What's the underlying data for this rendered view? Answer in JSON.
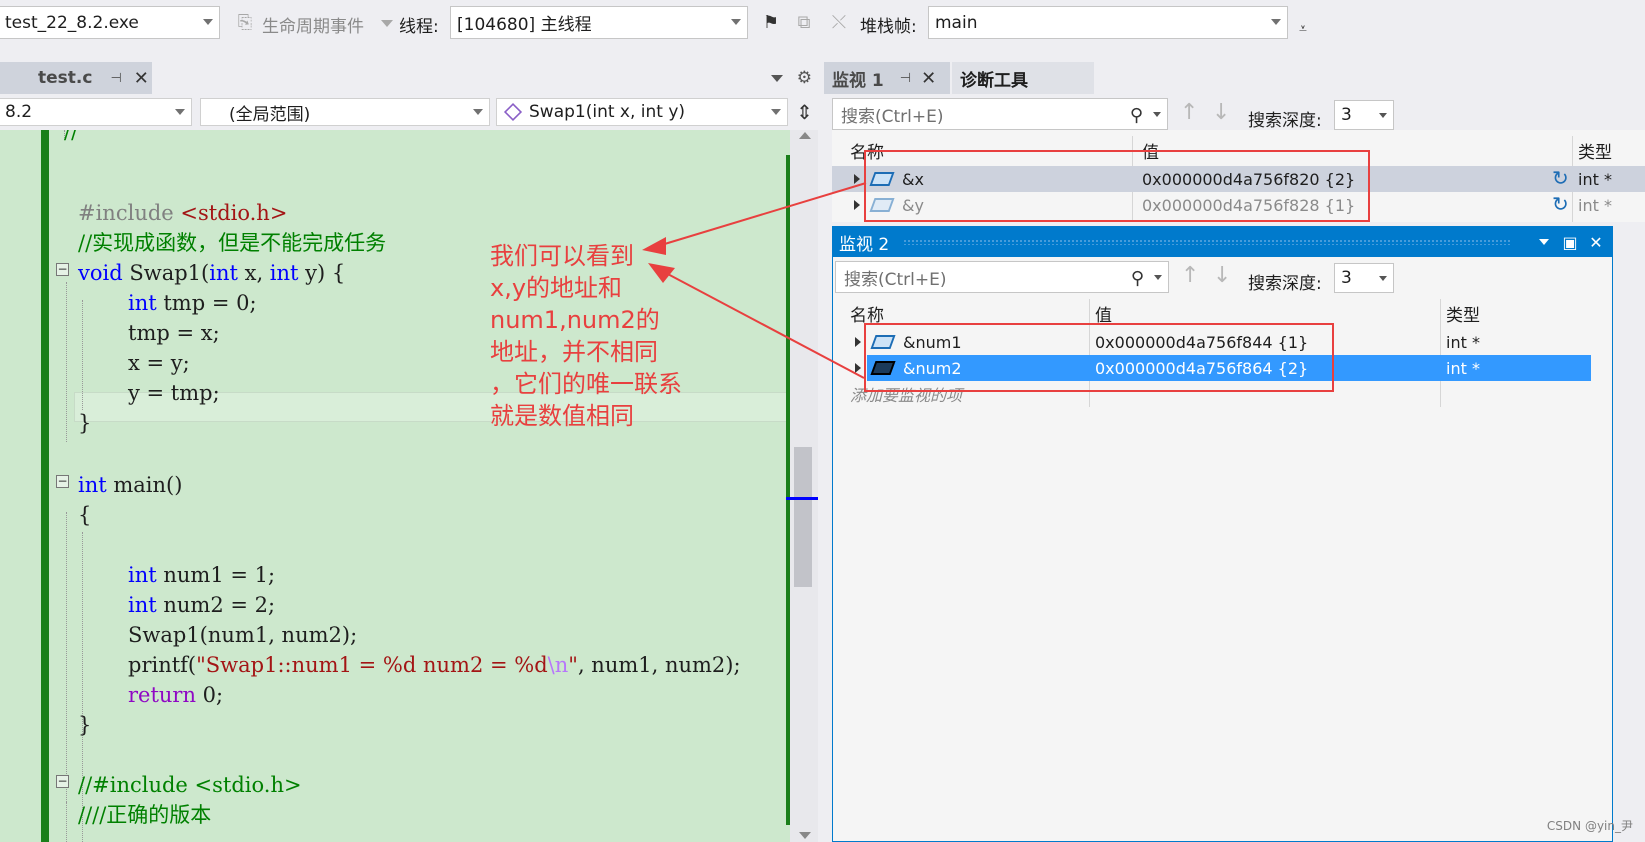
{
  "toolbar": {
    "process": "test_22_8.2.exe",
    "lifecycle": "生命周期事件",
    "thread_label": "线程:",
    "thread": "[104680] 主线程",
    "stack_label": "堆栈帧:",
    "stack": "main"
  },
  "editor": {
    "tab": "test.c",
    "nav_project": "8.2",
    "nav_scope": "(全局范围)",
    "nav_function": "Swap1(int x, int y)"
  },
  "code": {
    "l0": "//",
    "l1_pp": "#include ",
    "l1_hdr": "<stdio.h>",
    "l2": "//实现成函数，但是不能完成任务",
    "l3_kw": "void",
    "l3_a": " Swap1(",
    "l3_kw2": "int",
    "l3_b": " x, ",
    "l3_kw3": "int",
    "l3_c": " y) {",
    "l4_kw": "int",
    "l4_rest": " tmp = 0;",
    "l5": "tmp = x;",
    "l6": "x = y;",
    "l7": "y = tmp;",
    "l8": "}",
    "l10_kw": "int",
    "l10_rest": " main()",
    "l11": "{",
    "l13_kw": "int",
    "l13_rest": " num1 = 1;",
    "l14_kw": "int",
    "l14_rest": " num2 = 2;",
    "l15": "Swap1(num1, num2);",
    "l16_a": "printf(",
    "l16_str": "\"Swap1::num1 = %d num2 = %d",
    "l16_esc": "\\n",
    "l16_str2": "\"",
    "l16_b": ", num1, num2);",
    "l17_kw": "return",
    "l17_rest": " 0;",
    "l18": "}",
    "l20": "//#include <stdio.h>",
    "l21": "////正确的版本"
  },
  "watch1": {
    "tab": "监视 1",
    "tab2": "诊断工具",
    "search": "搜索(Ctrl+E)",
    "depth_label": "搜索深度:",
    "depth": "3",
    "col_name": "名称",
    "col_value": "值",
    "col_type": "类型",
    "rows": [
      {
        "name": "&x",
        "value": "0x000000d4a756f820 {2}",
        "type": "int *"
      },
      {
        "name": "&y",
        "value": "0x000000d4a756f828 {1}",
        "type": "int *"
      }
    ]
  },
  "watch2": {
    "title": "监视 2",
    "search": "搜索(Ctrl+E)",
    "depth_label": "搜索深度:",
    "depth": "3",
    "col_name": "名称",
    "col_value": "值",
    "col_type": "类型",
    "rows": [
      {
        "name": "&num1",
        "value": "0x000000d4a756f844 {1}",
        "type": "int *"
      },
      {
        "name": "&num2",
        "value": "0x000000d4a756f864 {2}",
        "type": "int *"
      }
    ],
    "add_placeholder": "添加要监视的项"
  },
  "annotation": {
    "text": "我们可以看到\nx,y的地址和\nnum1,num2的\n地址，并不相同\n，它们的唯一联系\n就是数值相同"
  },
  "watermark": "CSDN @yin_尹",
  "colors": {
    "accent": "#007acc",
    "annotation": "#e8403f",
    "editor_bg": "#cde8cd",
    "selection": "#3399ff"
  }
}
